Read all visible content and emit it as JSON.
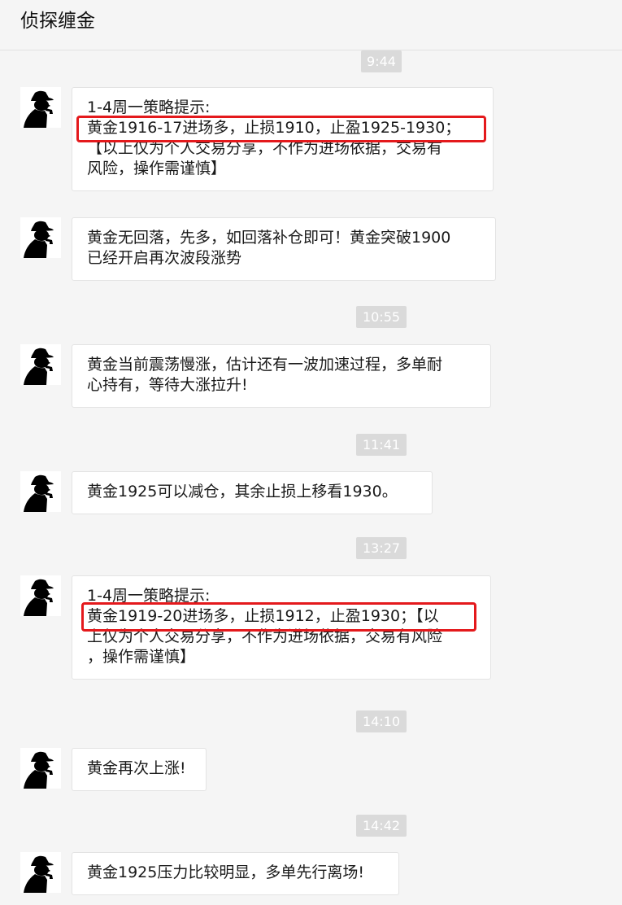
{
  "header": {
    "title": "侦探缠金"
  },
  "messages": [
    {
      "time": "9:44",
      "lines": [
        "1-4周一策略提示:",
        "黄金1916-17进场多，止损1910，止盈1925-1930；",
        "【以上仅为个人交易分享，不作为进场依据，交易有",
        "风险，操作需谨慎】"
      ]
    },
    {
      "lines": [
        "黄金无回落，先多，如回落补仓即可！黄金突破1900",
        "已经开启再次波段涨势"
      ]
    },
    {
      "time": "10:55",
      "lines": [
        "黄金当前震荡慢涨，估计还有一波加速过程，多单耐",
        "心持有，等待大涨拉升!"
      ]
    },
    {
      "time": "11:41",
      "lines": [
        "黄金1925可以减仓，其余止损上移看1930。"
      ]
    },
    {
      "time": "13:27",
      "lines": [
        "1-4周一策略提示:",
        "黄金1919-20进场多，止损1912，止盈1930；【以",
        "上仅为个人交易分享，不作为进场依据，交易有风险",
        "，操作需谨慎】"
      ]
    },
    {
      "time": "14:10",
      "lines": [
        "黄金再次上涨!"
      ]
    },
    {
      "time": "14:42",
      "lines": [
        "黄金1925压力比较明显，多单先行离场!"
      ]
    }
  ],
  "colors": {
    "background": "#f5f5f5",
    "bubble": "#ffffff",
    "timestamp_bg": "#dadada",
    "highlight": "#e4191c"
  },
  "icons": {
    "avatar": "detective-silhouette-icon"
  }
}
